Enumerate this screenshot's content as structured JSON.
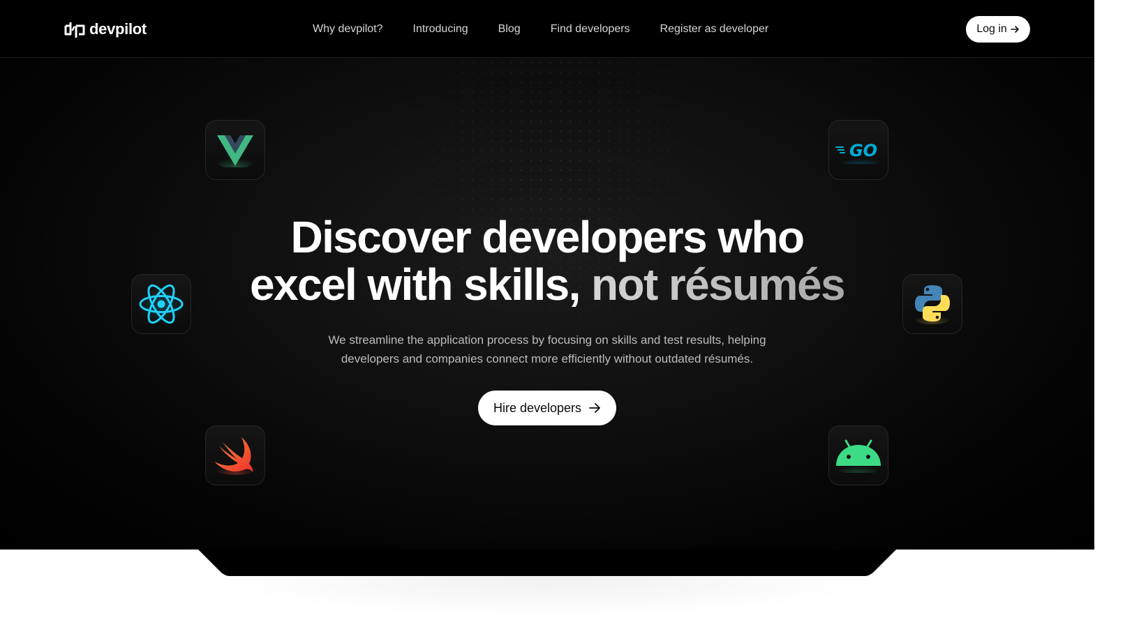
{
  "brand": {
    "name": "devpilot"
  },
  "nav": {
    "items": [
      {
        "label": "Why devpilot?"
      },
      {
        "label": "Introducing"
      },
      {
        "label": "Blog"
      },
      {
        "label": "Find developers"
      },
      {
        "label": "Register as developer"
      }
    ],
    "login_label": "Log in"
  },
  "hero": {
    "headline_line1": "Discover developers who",
    "headline_line2_a": "excel with skills,",
    "headline_line2_b": " not résumés",
    "subtitle_line1": "We streamline the application process by focusing on skills and test results, helping",
    "subtitle_line2": "developers and companies connect more efficiently without outdated résumés.",
    "cta_label": "Hire developers"
  },
  "tech_tiles": [
    {
      "icon": "vue-icon"
    },
    {
      "icon": "go-icon",
      "text": "GO"
    },
    {
      "icon": "react-icon"
    },
    {
      "icon": "python-icon"
    },
    {
      "icon": "swift-icon"
    },
    {
      "icon": "android-icon"
    }
  ],
  "colors": {
    "header_bg": "#000000",
    "hero_bg": "#0f0f0f",
    "button_bg": "#ffffff",
    "vue_green": "#41b883",
    "vue_dark": "#34495e",
    "react_cyan": "#1fd1f9",
    "go_cyan": "#00add8",
    "python_blue": "#4584b6",
    "python_yellow": "#ffde57",
    "swift_orange": "#f05138",
    "android_green": "#3ddc84"
  }
}
